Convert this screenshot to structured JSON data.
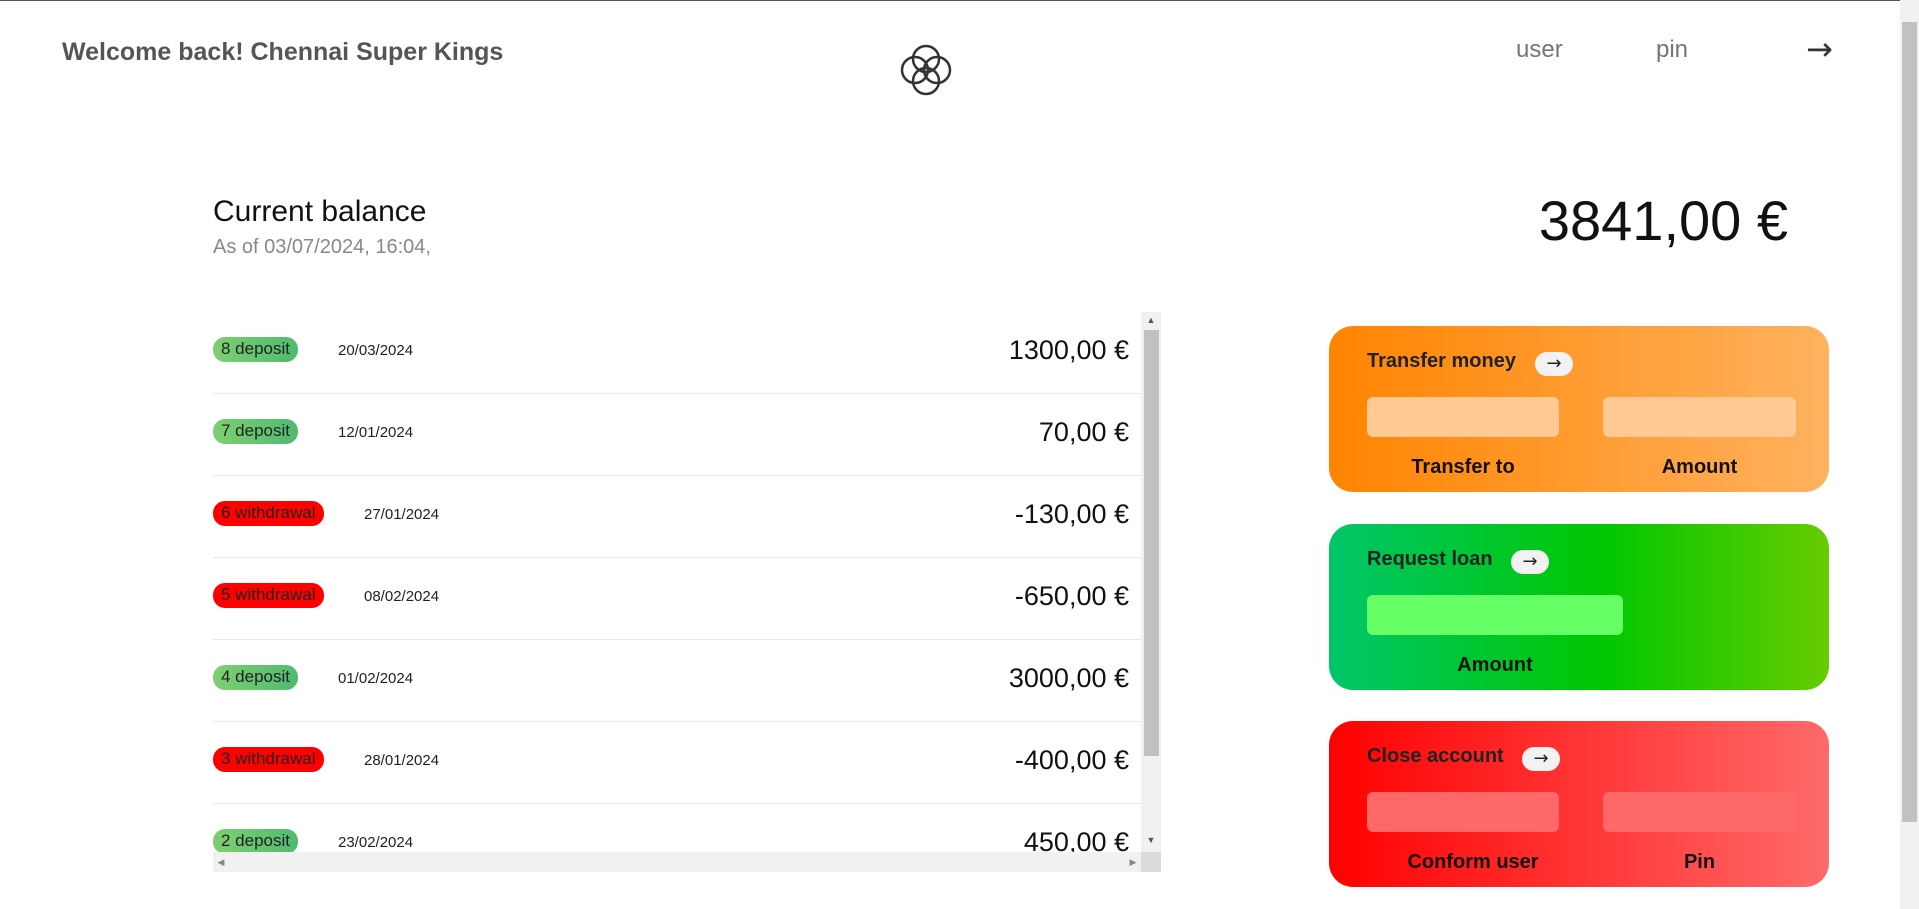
{
  "header": {
    "welcome": "Welcome back! Chennai Super Kings",
    "user_placeholder": "user",
    "pin_placeholder": "pin",
    "login_button": "→",
    "logo_icon": "four-circles-logo-icon"
  },
  "balance": {
    "label": "Current balance",
    "date": "As of 03/07/2024, 16:04,",
    "value": "3841,00 €"
  },
  "movements": [
    {
      "type": "8 deposit",
      "kind": "deposit",
      "date": "20/03/2024",
      "value": "1300,00 €"
    },
    {
      "type": "7 deposit",
      "kind": "deposit",
      "date": "12/01/2024",
      "value": "70,00 €"
    },
    {
      "type": "6 withdrawal",
      "kind": "withdrawal",
      "date": "27/01/2024",
      "value": "-130,00 €"
    },
    {
      "type": "5 withdrawal",
      "kind": "withdrawal",
      "date": "08/02/2024",
      "value": "-650,00 €"
    },
    {
      "type": "4 deposit",
      "kind": "deposit",
      "date": "01/02/2024",
      "value": "3000,00 €"
    },
    {
      "type": "3 withdrawal",
      "kind": "withdrawal",
      "date": "28/01/2024",
      "value": "-400,00 €"
    },
    {
      "type": "2 deposit",
      "kind": "deposit",
      "date": "23/02/2024",
      "value": "450,00 €"
    }
  ],
  "operations": {
    "transfer": {
      "title": "Transfer money",
      "button": "→",
      "label_to": "Transfer to",
      "label_amount": "Amount"
    },
    "loan": {
      "title": "Request loan",
      "button": "→",
      "label_amount": "Amount"
    },
    "close": {
      "title": "Close account",
      "button": "→",
      "label_user": "Conform user",
      "label_pin": "Pin"
    }
  },
  "colors": {
    "deposit": "#4fba6f",
    "withdrawal": "#ff0000",
    "transfer": "#ff8400",
    "loan": "#00c700",
    "close": "#ff0000"
  }
}
